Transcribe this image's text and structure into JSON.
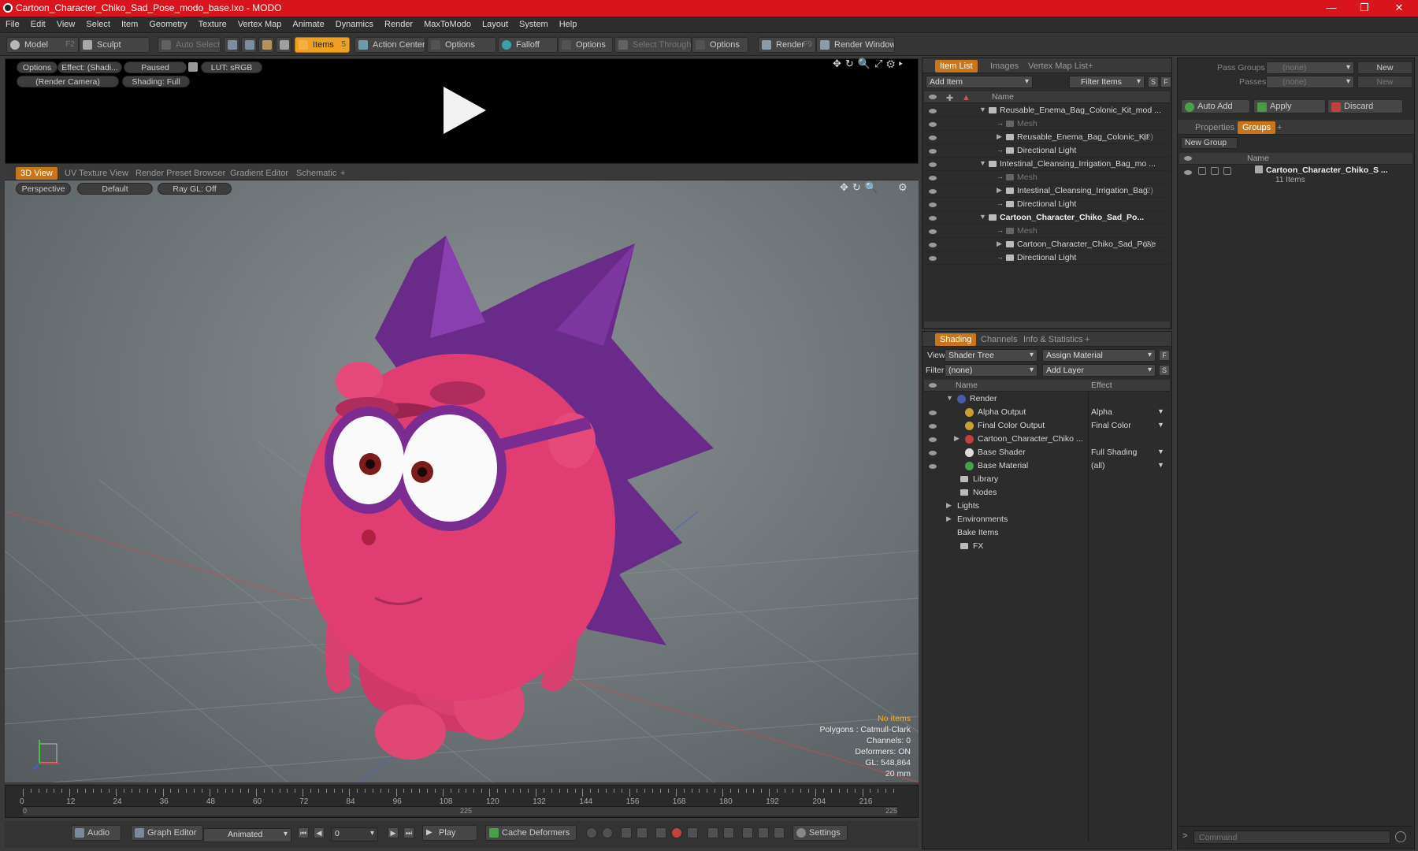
{
  "window": {
    "title": "Cartoon_Character_Chiko_Sad_Pose_modo_base.lxo - MODO",
    "minimize": "—",
    "maximize": "❐",
    "close": "✕"
  },
  "menu": [
    "File",
    "Edit",
    "View",
    "Select",
    "Item",
    "Geometry",
    "Texture",
    "Vertex Map",
    "Animate",
    "Dynamics",
    "Render",
    "MaxToModo",
    "Layout",
    "System",
    "Help"
  ],
  "toolbar": {
    "model": "Model",
    "model_key": "F2",
    "sculpt": "Sculpt",
    "auto_select": "Auto Select",
    "items": "Items",
    "items_key": "5",
    "action_center": "Action Center",
    "options1": "Options",
    "falloff": "Falloff",
    "options2": "Options",
    "select_through": "Select Through",
    "options3": "Options",
    "render": "Render",
    "render_key": "F9",
    "render_window": "Render Window"
  },
  "preview": {
    "options": "Options",
    "effect": "Effect: (Shadi...",
    "paused": "Paused",
    "lut": "LUT: sRGB",
    "camera": "(Render Camera)",
    "shading": "Shading: Full"
  },
  "viewport": {
    "tabs": [
      "3D View",
      "UV Texture View",
      "Render Preset Browser",
      "Gradient Editor",
      "Schematic"
    ],
    "perspective": "Perspective",
    "default": "Default",
    "raygl": "Ray GL: Off",
    "stats": {
      "no_items": "No Items",
      "polygons": "Polygons : Catmull-Clark",
      "channels": "Channels: 0",
      "deformers": "Deformers: ON",
      "gl": "GL: 548,864",
      "size": "20 mm"
    }
  },
  "timeline": {
    "ticks": [
      "0",
      "12",
      "24",
      "36",
      "48",
      "60",
      "72",
      "84",
      "96",
      "108",
      "120",
      "132",
      "144",
      "156",
      "168",
      "180",
      "192",
      "204",
      "216"
    ],
    "start": "0",
    "mid": "225",
    "end": "225"
  },
  "bottom": {
    "audio": "Audio",
    "graph_editor": "Graph Editor",
    "animated": "Animated",
    "frame": "0",
    "play": "Play",
    "cache_deformers": "Cache Deformers",
    "settings": "Settings"
  },
  "item_list": {
    "tabs": [
      "Item List",
      "Images",
      "Vertex Map List"
    ],
    "add_item": "Add Item",
    "filter_items": "Filter Items",
    "col_name": "Name",
    "rows": [
      {
        "label": "Reusable_Enema_Bag_Colonic_Kit_mod ...",
        "indent": 0,
        "bold": false,
        "dim": false
      },
      {
        "label": "Mesh",
        "indent": 1,
        "bold": false,
        "dim": true
      },
      {
        "label": "Reusable_Enema_Bag_Colonic_Kit",
        "count": "(2)",
        "indent": 1,
        "bold": false,
        "dim": false
      },
      {
        "label": "Directional Light",
        "indent": 1,
        "bold": false,
        "dim": false
      },
      {
        "label": "Intestinal_Cleansing_Irrigation_Bag_mo ...",
        "indent": 0,
        "bold": false,
        "dim": false
      },
      {
        "label": "Mesh",
        "indent": 1,
        "bold": false,
        "dim": true
      },
      {
        "label": "Intestinal_Cleansing_Irrigation_Bag",
        "count": "(2)",
        "indent": 1,
        "bold": false,
        "dim": false
      },
      {
        "label": "Directional Light",
        "indent": 1,
        "bold": false,
        "dim": false
      },
      {
        "label": "Cartoon_Character_Chiko_Sad_Po...",
        "indent": 0,
        "bold": true,
        "dim": false
      },
      {
        "label": "Mesh",
        "indent": 1,
        "bold": false,
        "dim": true
      },
      {
        "label": "Cartoon_Character_Chiko_Sad_Pose",
        "count": "(2)",
        "indent": 1,
        "bold": false,
        "dim": false
      },
      {
        "label": "Directional Light",
        "indent": 1,
        "bold": false,
        "dim": false
      }
    ]
  },
  "shading": {
    "tabs": [
      "Shading",
      "Channels",
      "Info & Statistics"
    ],
    "view_label": "View",
    "view_value": "Shader Tree",
    "assign_material": "Assign Material",
    "filter_label": "Filter",
    "filter_value": "(none)",
    "add_layer": "Add Layer",
    "col_name": "Name",
    "col_effect": "Effect",
    "rows": [
      {
        "label": "Render",
        "effect": ""
      },
      {
        "label": "Alpha Output",
        "effect": "Alpha"
      },
      {
        "label": "Final Color Output",
        "effect": "Final Color"
      },
      {
        "label": "Cartoon_Character_Chiko ...",
        "effect": ""
      },
      {
        "label": "Base Shader",
        "effect": "Full Shading"
      },
      {
        "label": "Base Material",
        "effect": "(all)"
      },
      {
        "label": "Library",
        "effect": ""
      },
      {
        "label": "Nodes",
        "effect": ""
      },
      {
        "label": "Lights",
        "effect": ""
      },
      {
        "label": "Environments",
        "effect": ""
      },
      {
        "label": "Bake Items",
        "effect": ""
      },
      {
        "label": "FX",
        "effect": ""
      }
    ]
  },
  "groups": {
    "pass_groups": "Pass Groups",
    "passes": "Passes",
    "none1": "(none)",
    "none2": "(none)",
    "new1": "New",
    "new2": "New",
    "auto_add": "Auto Add",
    "apply": "Apply",
    "discard": "Discard",
    "tabs": [
      "Properties",
      "Groups"
    ],
    "new_group": "New Group",
    "col_name": "Name",
    "item_name": "Cartoon_Character_Chiko_S ...",
    "item_count": "11 Items"
  },
  "command": {
    "placeholder": "Command"
  },
  "colors": {
    "accent": "#c7761b",
    "title_red": "#d8141c",
    "body_pink": "#e03d72",
    "spike_purple": "#6a2a8a"
  }
}
